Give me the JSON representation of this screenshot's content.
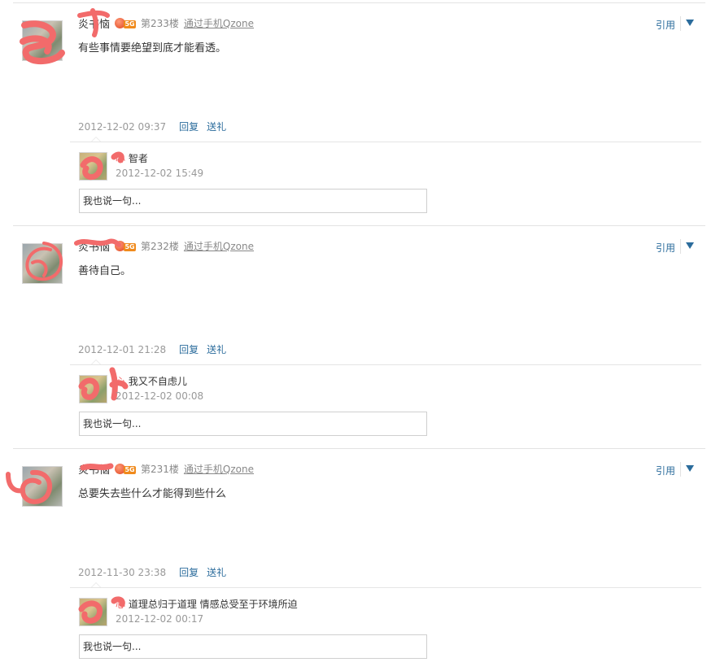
{
  "posts": [
    {
      "username": "炎书恼",
      "level": "5G",
      "floor": "第233楼",
      "via": "通过手机Qzone",
      "content": "有些事情要绝望到底才能看透。",
      "date": "2012-12-02 09:37",
      "reply_label": "回复",
      "gift_label": "送礼",
      "quote_label": "引用",
      "reply": {
        "author": "心",
        "text": "智者",
        "date": "2012-12-02 15:49"
      },
      "input_placeholder": "我也说一句..."
    },
    {
      "username": "炎书恼",
      "level": "5G",
      "floor": "第232楼",
      "via": "通过手机Qzone",
      "content": "善待自己。",
      "date": "2012-12-01 21:28",
      "reply_label": "回复",
      "gift_label": "送礼",
      "quote_label": "引用",
      "reply": {
        "author": "心",
        "text": "我又不自虑儿",
        "date": "2012-12-02 00:08"
      },
      "input_placeholder": "我也说一句..."
    },
    {
      "username": "炎书恼",
      "level": "5G",
      "floor": "第231楼",
      "via": "通过手机Qzone",
      "content": "总要失去些什么才能得到些什么",
      "date": "2012-11-30 23:38",
      "reply_label": "回复",
      "gift_label": "送礼",
      "quote_label": "引用",
      "reply": {
        "author": "心",
        "text": "道理总归于道理 情感总受至于环境所迫",
        "date": "2012-12-02 00:17"
      },
      "input_placeholder": "我也说一句..."
    }
  ],
  "colors": {
    "link": "#2b6c9c",
    "muted": "#999999",
    "text": "#333333",
    "scribble": "#f26b6b",
    "badge": "#f08a1c"
  },
  "icons": {
    "level": "apple-level-badge-icon",
    "menu": "triangle-down-icon"
  }
}
